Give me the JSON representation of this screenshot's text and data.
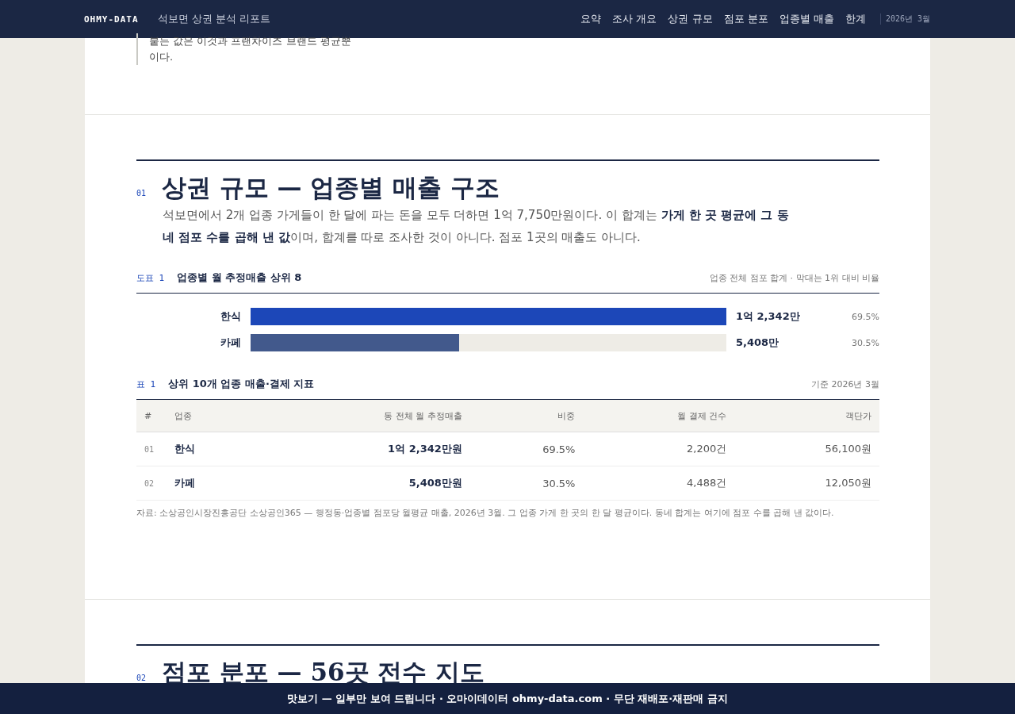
{
  "header": {
    "logo": "OHMY-DATA",
    "subtitle": "석보면 상권 분석 리포트",
    "nav": [
      {
        "label": "요약",
        "selected": false
      },
      {
        "label": "조사 개요",
        "selected": false
      },
      {
        "label": "상권 규모",
        "selected": false
      },
      {
        "label": "점포 분포",
        "selected": false
      },
      {
        "label": "업종별 매출",
        "selected": false
      },
      {
        "label": "한계",
        "selected": false
      }
    ],
    "date": "2026년 3월"
  },
  "quote": {
    "text": "붙는 값은 이것과 프랜차이즈 브랜드 평균뿐이다."
  },
  "sections": [
    {
      "number": "01",
      "title": "상권 규모 — 업종별 매출 구조",
      "lead": "석보면에서 2개 업종 가게들이 한 달에 파는 돈을 모두 더하면 1억 7,750만원이다. 이 합계는 **가게 한 곳 평균에 그 동네 점포 수를 곱해 낸 값**이며, 합계를 따로 조사한 것이 아니다. 점포 1곳의 매출도 아니다.",
      "figure": {
        "label": "도표 1",
        "title": "업종별 월 추정매출 상위 8",
        "note": "업종 전체 점포 합계 · 막대는 1위 대비 비율",
        "bars": [
          {
            "label": "한식",
            "value": "1억 2,342만",
            "share": "69.5%",
            "level": 1,
            "color": "#1c47b8"
          },
          {
            "label": "카페",
            "value": "5,408만",
            "share": "30.5%",
            "level": 0.438,
            "color": "#42598c"
          }
        ]
      },
      "table": {
        "label": "표 1",
        "title": "상위 10개 업종 매출·결제 지표",
        "note": "기준 2026년 3월",
        "columns": [
          "#",
          "업종",
          "동 전체 월 추정매출",
          "비중",
          "월 결제 건수",
          "객단가"
        ],
        "rows": [
          [
            "01",
            "한식",
            "1억 2,342만원",
            "69.5%",
            "2,200건",
            "56,100원"
          ],
          [
            "02",
            "카페",
            "5,408만원",
            "30.5%",
            "4,488건",
            "12,050원"
          ]
        ],
        "source": "자료: 소상공인시장진흥공단 소상공인365 — 행정동·업종별 점포당 월평균 매출, 2026년 3월. 그 업종 가게 한 곳의 한 달 평균이다. 동네 합계는 여기에 점포 수를 곱해 낸 값이다."
      }
    },
    {
      "number": "02",
      "title": "점포 분포 — 56곳 전수 지도"
    }
  ],
  "footer": {
    "text": "맛보기 — 일부만 보여 드립니다 · 오마이데이터 ohmy-data.com · 무단 재배포·재판매 금지"
  }
}
